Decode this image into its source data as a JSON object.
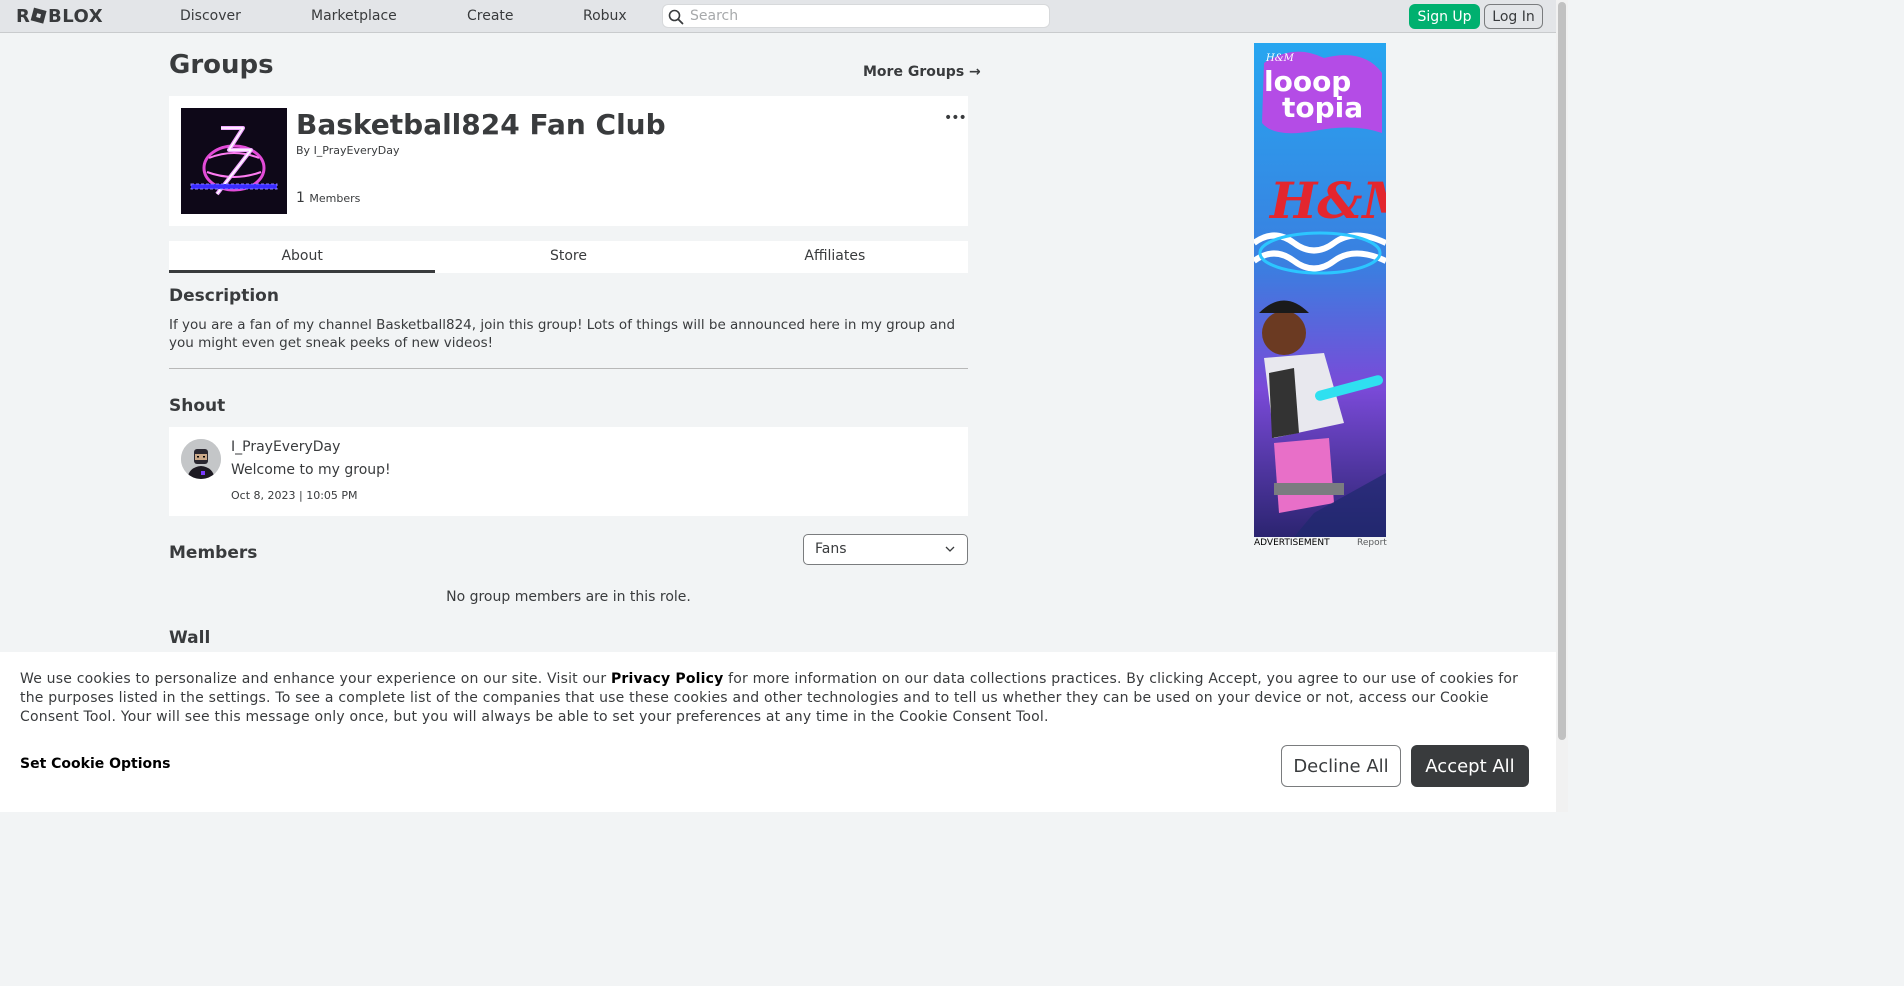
{
  "header": {
    "logo_text": "ROBLOX",
    "nav": [
      {
        "label": "Discover"
      },
      {
        "label": "Marketplace"
      },
      {
        "label": "Create"
      },
      {
        "label": "Robux"
      }
    ],
    "search_placeholder": "Search",
    "signup_label": "Sign Up",
    "login_label": "Log In"
  },
  "page": {
    "title": "Groups",
    "more_groups": "More Groups →"
  },
  "group": {
    "name": "Basketball824 Fan Club",
    "by_prefix": "By",
    "owner": "I_PrayEveryDay",
    "member_count": "1",
    "members_label": "Members",
    "menu_glyph": "•••"
  },
  "tabs": [
    {
      "label": "About",
      "active": true
    },
    {
      "label": "Store",
      "active": false
    },
    {
      "label": "Affiliates",
      "active": false
    }
  ],
  "description": {
    "heading": "Description",
    "text": "If you are a fan of my channel Basketball824, join this group! Lots of things will be announced here in my group and you might even get sneak peeks of new videos!"
  },
  "shout": {
    "heading": "Shout",
    "author": "I_PrayEveryDay",
    "body": "Welcome to my group!",
    "timestamp": "Oct 8, 2023 | 10:05 PM"
  },
  "members": {
    "heading": "Members",
    "role_selected": "Fans",
    "empty_text": "No group members are in this role."
  },
  "wall": {
    "heading": "Wall"
  },
  "ad": {
    "brand_small": "H&M",
    "headline_1": "looop",
    "headline_2": "topia",
    "brand_big": "H&M",
    "label": "ADVERTISEMENT",
    "report": "Report"
  },
  "cookie": {
    "text_before_link": "We use cookies to personalize and enhance your experience on our site. Visit our ",
    "link_text": "Privacy Policy",
    "text_after_link": " for more information on our data collections practices. By clicking Accept, you agree to our use of cookies for the purposes listed in the settings. To see a complete list of the companies that use these cookies and other technologies and to tell us whether they can be used on your device or not, access our Cookie Consent Tool. Your will see this message only once, but you will always be able to set your preferences at any time in the Cookie Consent Tool.",
    "options_label": "Set Cookie Options",
    "decline_label": "Decline All",
    "accept_label": "Accept All"
  },
  "colors": {
    "accent_green": "#00b06f",
    "page_bg": "#f2f4f5",
    "text": "#393b3d"
  }
}
